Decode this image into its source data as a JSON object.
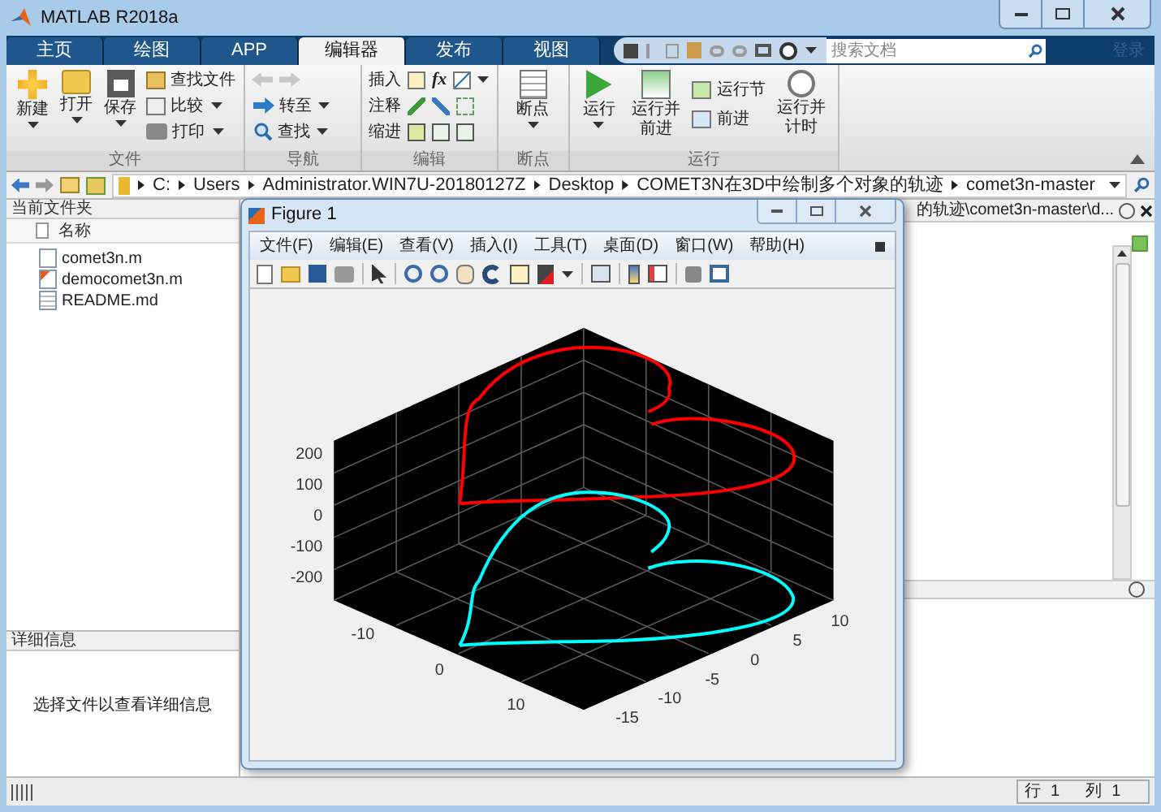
{
  "window": {
    "title": "MATLAB R2018a"
  },
  "tabs": [
    {
      "label": "主页",
      "selected": false
    },
    {
      "label": "绘图",
      "selected": false
    },
    {
      "label": "APP",
      "selected": false
    },
    {
      "label": "编辑器",
      "selected": true
    },
    {
      "label": "发布",
      "selected": false
    },
    {
      "label": "视图",
      "selected": false
    }
  ],
  "search": {
    "placeholder": "搜索文档"
  },
  "login_link": "登录",
  "ribbon": {
    "file": {
      "label": "文件",
      "new": "新建",
      "open": "打开",
      "save": "保存",
      "find_files": "查找文件",
      "compare": "比较",
      "print": "打印"
    },
    "navigate": {
      "label": "导航",
      "go_to": "转至",
      "find": "查找"
    },
    "edit": {
      "label": "编辑",
      "insert": "插入",
      "fx": "fx",
      "comment": "注释",
      "indent": "缩进"
    },
    "breakpoints": {
      "label": "断点",
      "breakpoints": "断点"
    },
    "run": {
      "label": "运行",
      "run": "运行",
      "run_advance": "运行并前进",
      "run_section": "运行节",
      "advance": "前进",
      "run_time": "运行并计时"
    }
  },
  "path": [
    "C:",
    "Users",
    "Administrator.WIN7U-20180127Z",
    "Desktop",
    "COMET3N在3D中绘制多个对象的轨迹",
    "comet3n-master"
  ],
  "current_folder": {
    "title": "当前文件夹",
    "column": "名称",
    "files": [
      {
        "name": "comet3n.m",
        "kind": "function"
      },
      {
        "name": "democomet3n.m",
        "kind": "script"
      },
      {
        "name": "README.md",
        "kind": "text"
      }
    ]
  },
  "details": {
    "title": "详细信息",
    "message": "选择文件以查看详细信息"
  },
  "editor": {
    "tab_title": "的轨迹\\comet3n-master\\d..."
  },
  "status_bar": {
    "row_label": "行",
    "row": "1",
    "col_label": "列",
    "col": "1"
  },
  "figure": {
    "title": "Figure 1",
    "menu": [
      "文件(F)",
      "编辑(E)",
      "查看(V)",
      "插入(I)",
      "工具(T)",
      "桌面(D)",
      "窗口(W)",
      "帮助(H)"
    ],
    "plot": {
      "z_ticks": [
        "200",
        "100",
        "0",
        "-100",
        "-200"
      ],
      "x_ticks": [
        "-10",
        "0",
        "10"
      ],
      "y_ticks": [
        "10",
        "5",
        "0",
        "-5",
        "-10",
        "-15"
      ],
      "curves": [
        {
          "color": "#ff0000"
        },
        {
          "color": "#00ffff"
        }
      ]
    }
  }
}
